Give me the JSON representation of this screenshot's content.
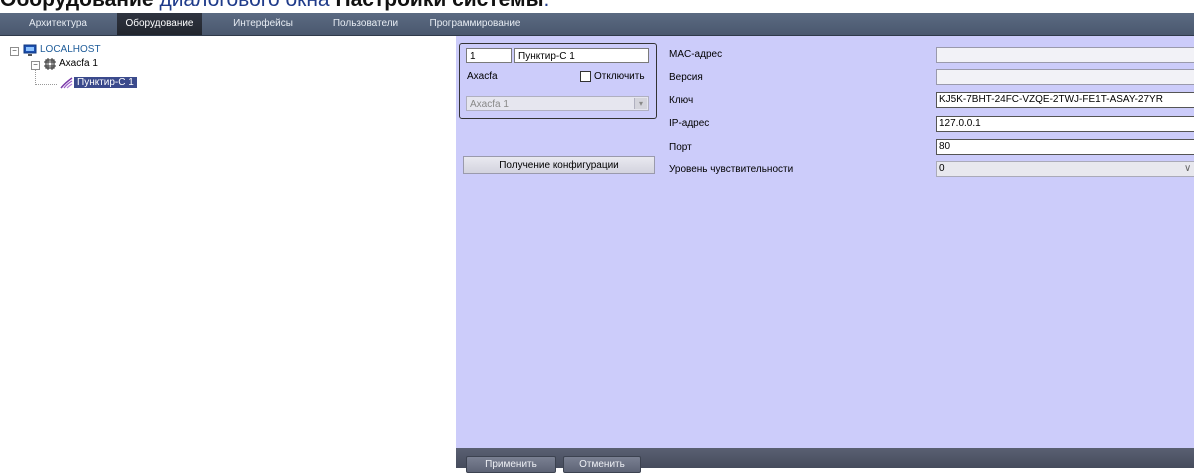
{
  "caption": {
    "bold1": "Оборудование",
    "link": "диалогового окна",
    "bold2": "Настройки системы",
    "tail": "."
  },
  "tabs": [
    {
      "label": "Архитектура",
      "active": false
    },
    {
      "label": "Оборудование",
      "active": true
    },
    {
      "label": "Интерфейсы",
      "active": false
    },
    {
      "label": "Пользователи",
      "active": false
    },
    {
      "label": "Программирование",
      "active": false
    }
  ],
  "tree": {
    "root": {
      "label": "LOCALHOST",
      "icon": "computer-icon",
      "expander": "−"
    },
    "child": {
      "label": "Axacfa 1",
      "icon": "controller-icon",
      "expander": "−"
    },
    "leaf": {
      "label": "Пунктир-С 1",
      "icon": "sensor-wave-icon"
    }
  },
  "device": {
    "number": "1",
    "name": "Пунктир-С 1",
    "parent_label": "Axacfa",
    "disable_label": "Отключить",
    "disable_checked": false,
    "parent_select": "Axacfa 1"
  },
  "config_button": "Получение конфигурации",
  "properties": [
    {
      "label": "MAC-адрес",
      "value": ""
    },
    {
      "label": "Версия",
      "value": ""
    },
    {
      "label": "Ключ",
      "value": "KJ5K-7BHT-24FC-VZQE-2TWJ-FE1T-ASAY-27YR"
    },
    {
      "label": "IP-адрес",
      "value": "127.0.0.1"
    },
    {
      "label": "Порт",
      "value": "80"
    },
    {
      "label": "Уровень чувствительности",
      "value": "0"
    }
  ],
  "buttons": {
    "apply": "Применить",
    "cancel": "Отменить"
  },
  "colors": {
    "panel_bg": "#ccccfa",
    "tab_bar": "#4f5d74",
    "tab_active": "#262a33",
    "tree_selected": "#3b4a8c"
  }
}
